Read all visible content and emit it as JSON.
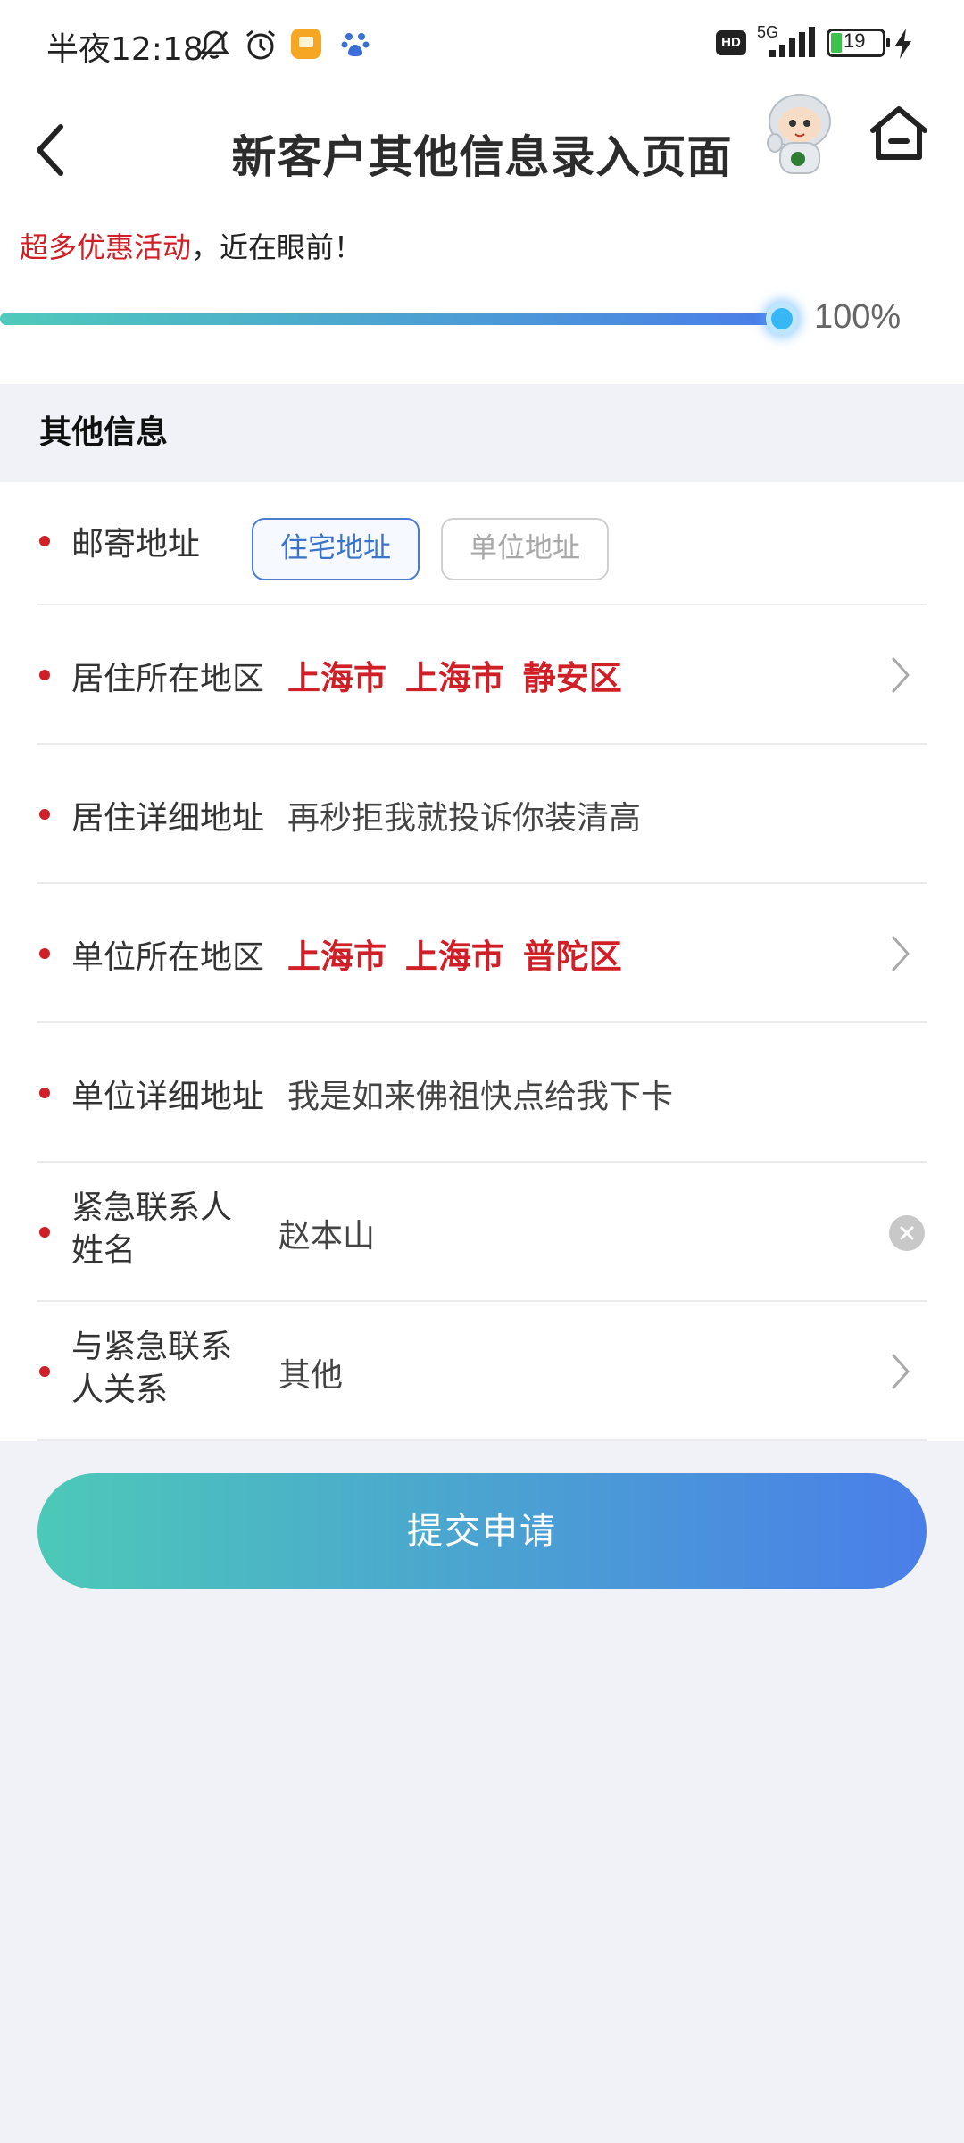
{
  "status_bar": {
    "time": "半夜12:18",
    "network": "5G",
    "hd_badge": "HD",
    "battery": "19"
  },
  "nav": {
    "title": "新客户其他信息录入页面"
  },
  "promo": {
    "highlight": "超多优惠活动",
    "rest": "，近在眼前！"
  },
  "progress": {
    "percent_text": "100%",
    "fraction": 1.0
  },
  "section": {
    "title": "其他信息"
  },
  "form": {
    "mailing": {
      "label": "邮寄地址",
      "option_home": "住宅地址",
      "option_work": "单位地址"
    },
    "res_region": {
      "label": "居住所在地区",
      "value": "上海市 上海市 静安区"
    },
    "res_detail": {
      "label": "居住详细地址",
      "value": "再秒拒我就投诉你装清高"
    },
    "work_region": {
      "label": "单位所在地区",
      "value": "上海市 上海市 普陀区"
    },
    "work_detail": {
      "label": "单位详细地址",
      "value": "我是如来佛祖快点给我下卡"
    },
    "emergency_name": {
      "label": "紧急联系人姓名",
      "value": "赵本山"
    },
    "emergency_relation": {
      "label": "与紧急联系人关系",
      "value": "其他"
    }
  },
  "submit": {
    "label": "提交申请"
  },
  "colors": {
    "accent_red": "#d01f26",
    "gradient_start": "#4cc9b8",
    "gradient_end": "#4a7ee9",
    "link_blue": "#3a73c9"
  }
}
